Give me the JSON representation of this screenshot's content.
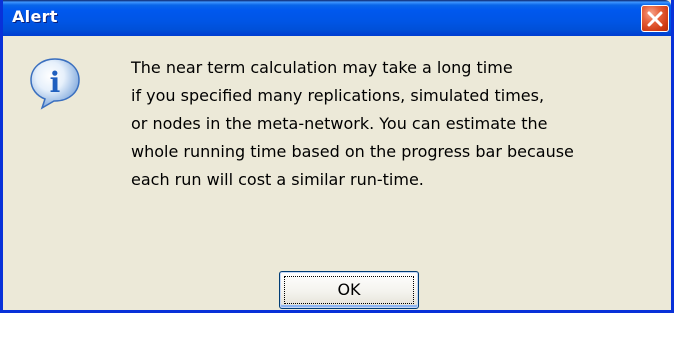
{
  "window": {
    "title": "Alert",
    "close_icon": "close-icon"
  },
  "dialog": {
    "icon": "info-icon",
    "icon_glyph": "i",
    "message_lines": [
      "The near term calculation may take a long time",
      "if you specified many replications, simulated times,",
      "or nodes in the meta-network. You can estimate the",
      "whole running time based on the progress bar because",
      "each run will cost a similar run-time."
    ],
    "ok_label": "OK"
  },
  "colors": {
    "titlebar": "#0055e5",
    "window_border": "#0831d9",
    "dialog_background": "#ece9d8",
    "close_button": "#e8643e",
    "info_icon": "#3a7fd5"
  }
}
